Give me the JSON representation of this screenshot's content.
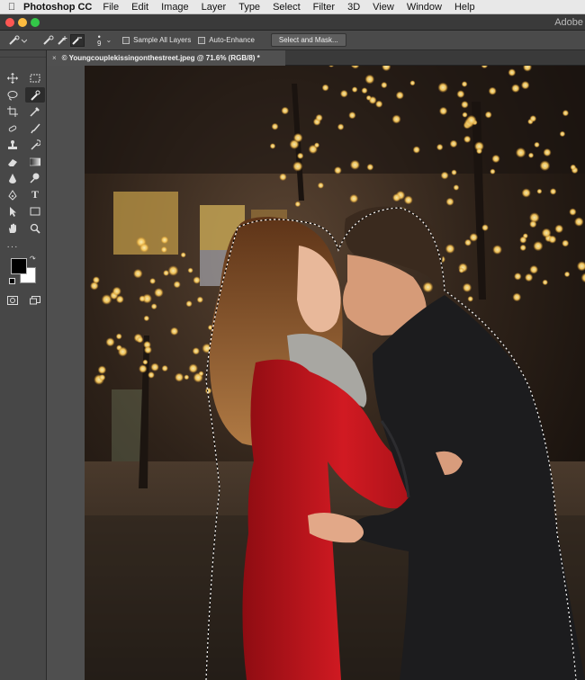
{
  "menubar": {
    "app_name": "Photoshop CC",
    "items": [
      "File",
      "Edit",
      "Image",
      "Layer",
      "Type",
      "Select",
      "Filter",
      "3D",
      "View",
      "Window",
      "Help"
    ]
  },
  "titlebar": {
    "right_label": "Adobe"
  },
  "options": {
    "brush_size": "9",
    "sample_all_layers": "Sample All Layers",
    "auto_enhance": "Auto-Enhance",
    "select_and_mask": "Select and Mask..."
  },
  "document": {
    "tab_title": "© Youngcouplekissingonthestreet.jpeg @ 71.6% (RGB/8) *"
  },
  "colors": {
    "foreground": "#000000",
    "background": "#ffffff",
    "coat": "#c8141c"
  },
  "tools": [
    [
      "move-icon",
      "marquee-icon"
    ],
    [
      "lasso-icon",
      "quick-selection-icon"
    ],
    [
      "crop-icon",
      "eyedropper-icon"
    ],
    [
      "healing-icon",
      "brush-icon"
    ],
    [
      "stamp-icon",
      "history-brush-icon"
    ],
    [
      "eraser-icon",
      "gradient-icon"
    ],
    [
      "blur-icon",
      "dodge-icon"
    ],
    [
      "pen-icon",
      "type-icon"
    ],
    [
      "path-selection-icon",
      "rectangle-icon"
    ],
    [
      "hand-icon",
      "zoom-icon"
    ]
  ]
}
